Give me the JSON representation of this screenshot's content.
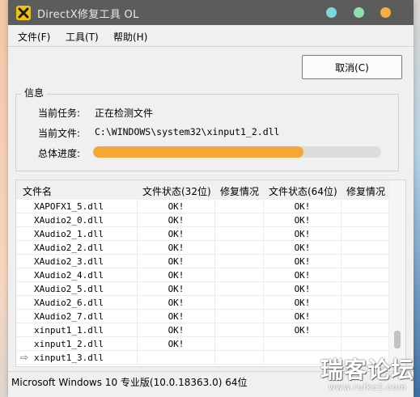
{
  "window": {
    "title": "DirectX修复工具 OL",
    "colors": {
      "dot1": "#7ed8d8",
      "dot2": "#8fe0ad",
      "dot3": "#f5b041"
    }
  },
  "menu": [
    "文件(F)",
    "工具(T)",
    "帮助(H)"
  ],
  "cancel_button": "取消(C)",
  "info": {
    "group_label": "信息",
    "task_label": "当前任务:",
    "task_value": "正在检测文件",
    "file_label": "当前文件:",
    "file_value": "C:\\WINDOWS\\system32\\xinput1_2.dll",
    "progress_label": "总体进度:",
    "progress_percent": 73,
    "progress_color": "#f5a735"
  },
  "table": {
    "headers": [
      "文件名",
      "文件状态(32位)",
      "修复情况",
      "文件状态(64位)",
      "修复情况"
    ],
    "rows": [
      {
        "name": "XAPOFX1_5.dll",
        "s32": "OK!",
        "r32": "",
        "s64": "OK!",
        "r64": "",
        "current": false
      },
      {
        "name": "XAudio2_0.dll",
        "s32": "OK!",
        "r32": "",
        "s64": "OK!",
        "r64": "",
        "current": false
      },
      {
        "name": "XAudio2_1.dll",
        "s32": "OK!",
        "r32": "",
        "s64": "OK!",
        "r64": "",
        "current": false
      },
      {
        "name": "XAudio2_2.dll",
        "s32": "OK!",
        "r32": "",
        "s64": "OK!",
        "r64": "",
        "current": false
      },
      {
        "name": "XAudio2_3.dll",
        "s32": "OK!",
        "r32": "",
        "s64": "OK!",
        "r64": "",
        "current": false
      },
      {
        "name": "XAudio2_4.dll",
        "s32": "OK!",
        "r32": "",
        "s64": "OK!",
        "r64": "",
        "current": false
      },
      {
        "name": "XAudio2_5.dll",
        "s32": "OK!",
        "r32": "",
        "s64": "OK!",
        "r64": "",
        "current": false
      },
      {
        "name": "XAudio2_6.dll",
        "s32": "OK!",
        "r32": "",
        "s64": "OK!",
        "r64": "",
        "current": false
      },
      {
        "name": "XAudio2_7.dll",
        "s32": "OK!",
        "r32": "",
        "s64": "OK!",
        "r64": "",
        "current": false
      },
      {
        "name": "xinput1_1.dll",
        "s32": "OK!",
        "r32": "",
        "s64": "OK!",
        "r64": "",
        "current": false
      },
      {
        "name": "xinput1_2.dll",
        "s32": "OK!",
        "r32": "",
        "s64": "",
        "r64": "",
        "current": false
      },
      {
        "name": "xinput1_3.dll",
        "s32": "",
        "r32": "",
        "s64": "",
        "r64": "",
        "current": true
      }
    ]
  },
  "status_bar": "Microsoft Windows 10 专业版(10.0.18363.0) 64位",
  "watermark": {
    "main": "瑞客论坛",
    "sub": "www.ruike1.com"
  }
}
